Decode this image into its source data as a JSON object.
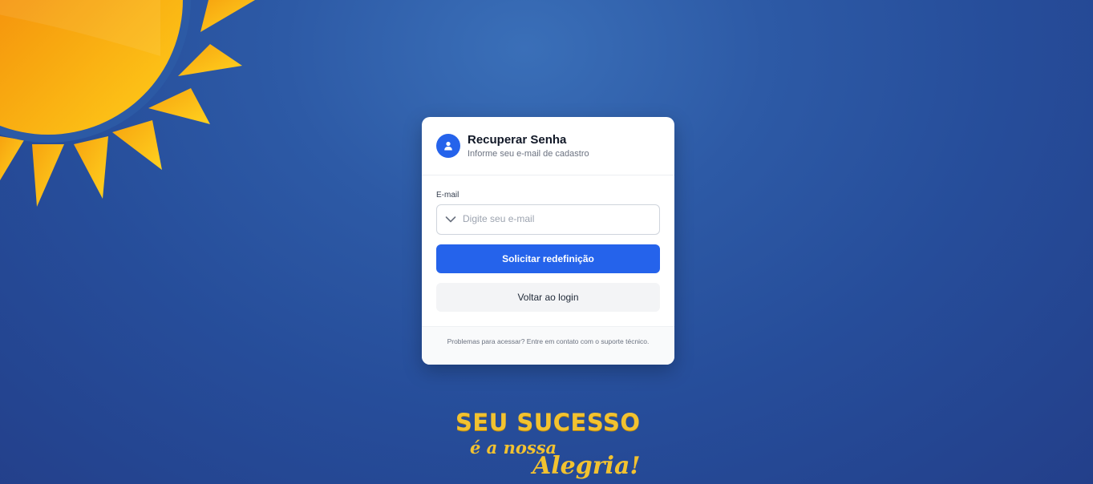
{
  "card": {
    "title": "Recuperar Senha",
    "subtitle": "Informe seu e-mail de cadastro",
    "email_label": "E-mail",
    "email_placeholder": "Digite seu e-mail",
    "email_value": "",
    "submit_label": "Solicitar redefinição",
    "back_label": "Voltar ao login",
    "footer_text": "Problemas para acessar? Entre em contato com o suporte técnico."
  },
  "icons": {
    "avatar": "user-icon",
    "email_field": "chevron-down-icon",
    "decoration": "sun-icon"
  },
  "slogan": {
    "line1": "SEU SUCESSO",
    "line2": "é a nossa",
    "line3": "Alegria!"
  },
  "colors": {
    "primary": "#2563eb",
    "background": "#2d5aa6",
    "slogan_gold": "#f2c230",
    "sun_orange": "#f39a0c"
  }
}
